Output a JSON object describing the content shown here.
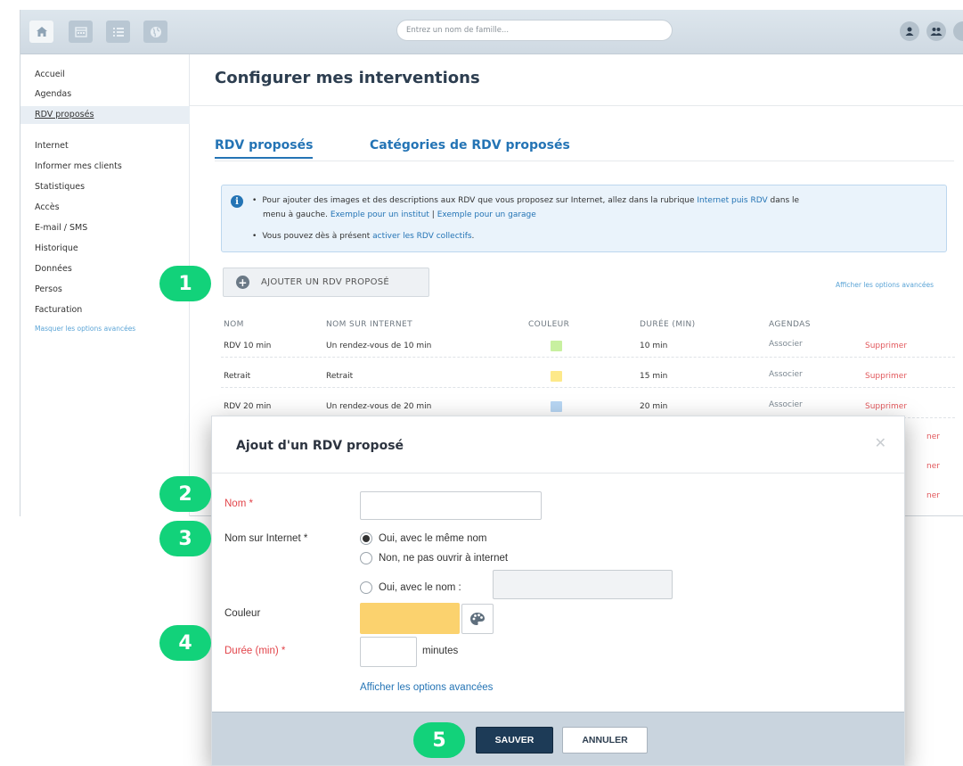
{
  "topbar": {
    "search_placeholder": "Entrez un nom de famille...",
    "nav_icons": [
      "home-icon",
      "calendar-icon",
      "list-icon",
      "globe-icon"
    ],
    "right_icons": [
      "user-icon",
      "users-icon"
    ]
  },
  "sidebar": {
    "items": [
      {
        "label": "Accueil"
      },
      {
        "label": "Agendas"
      },
      {
        "label": "RDV proposés",
        "selected": true
      },
      {
        "label": "Internet"
      },
      {
        "label": "Informer mes clients"
      },
      {
        "label": "Statistiques"
      },
      {
        "label": "Accès"
      },
      {
        "label": "E-mail / SMS"
      },
      {
        "label": "Historique"
      },
      {
        "label": "Données"
      },
      {
        "label": "Persos"
      },
      {
        "label": "Facturation"
      }
    ],
    "advanced_link": "Masquer les options avancées"
  },
  "main": {
    "title": "Configurer mes interventions",
    "tabs": [
      {
        "label": "RDV proposés",
        "active": true
      },
      {
        "label": "Catégories de RDV proposés",
        "active": false
      }
    ],
    "info": {
      "line1_text": "Pour ajouter des images et des descriptions aux RDV que vous proposez sur Internet, allez dans la rubrique",
      "line1_link": "Internet puis RDV",
      "line1_end": "dans le",
      "line2_text": "menu à gauche.",
      "line2_link1": "Exemple pour un institut",
      "line2_sep": "|",
      "line2_link2": "Exemple pour un garage",
      "line3_text": "Vous pouvez dès à présent",
      "line3_link": "activer les RDV collectifs",
      "line3_end": "."
    },
    "add_button": "AJOUTER UN RDV PROPOSÉ",
    "advanced_link": "Afficher les options avancées",
    "table": {
      "headers": [
        "NOM",
        "NOM SUR INTERNET",
        "COULEUR",
        "DURÉE (MIN)",
        "AGENDAS"
      ],
      "rows": [
        {
          "nom": "RDV 10 min",
          "internet": "Un rendez-vous de 10 min",
          "color": "#c8f0a0",
          "duree": "10 min",
          "agendas": "Associer",
          "action": "Supprimer"
        },
        {
          "nom": "Retrait",
          "internet": "Retrait",
          "color": "#fde98a",
          "duree": "15 min",
          "agendas": "Associer",
          "action": "Supprimer"
        },
        {
          "nom": "RDV 20 min",
          "internet": "Un rendez-vous de 20 min",
          "color": "#b7d6f3",
          "duree": "20 min",
          "agendas": "Associer",
          "action": "Supprimer"
        }
      ],
      "hidden_row_actions": [
        "ner",
        "ner",
        "ner"
      ]
    }
  },
  "modal": {
    "title": "Ajout d'un RDV proposé",
    "close_icon": "close-icon",
    "fields": {
      "nom_label": "Nom *",
      "nom_value": "",
      "internet_label": "Nom sur Internet *",
      "radio1": "Oui, avec le même nom",
      "radio2": "Non, ne pas ouvrir à internet",
      "radio3": "Oui, avec le nom :",
      "radio3_value": "",
      "couleur_label": "Couleur",
      "couleur_value": "#fbd26e",
      "duree_label": "Durée (min) *",
      "duree_value": "",
      "minutes_label": "minutes"
    },
    "advanced_link": "Afficher les options avancées",
    "save_button": "SAUVER",
    "cancel_button": "ANNULER"
  },
  "steps": [
    "1",
    "2",
    "3",
    "4",
    "5"
  ],
  "colors": {
    "accent": "#2474b5",
    "required": "#e2444a",
    "delete": "#e2585c",
    "step_marker": "#12d27a",
    "save_button": "#1d3b57"
  }
}
